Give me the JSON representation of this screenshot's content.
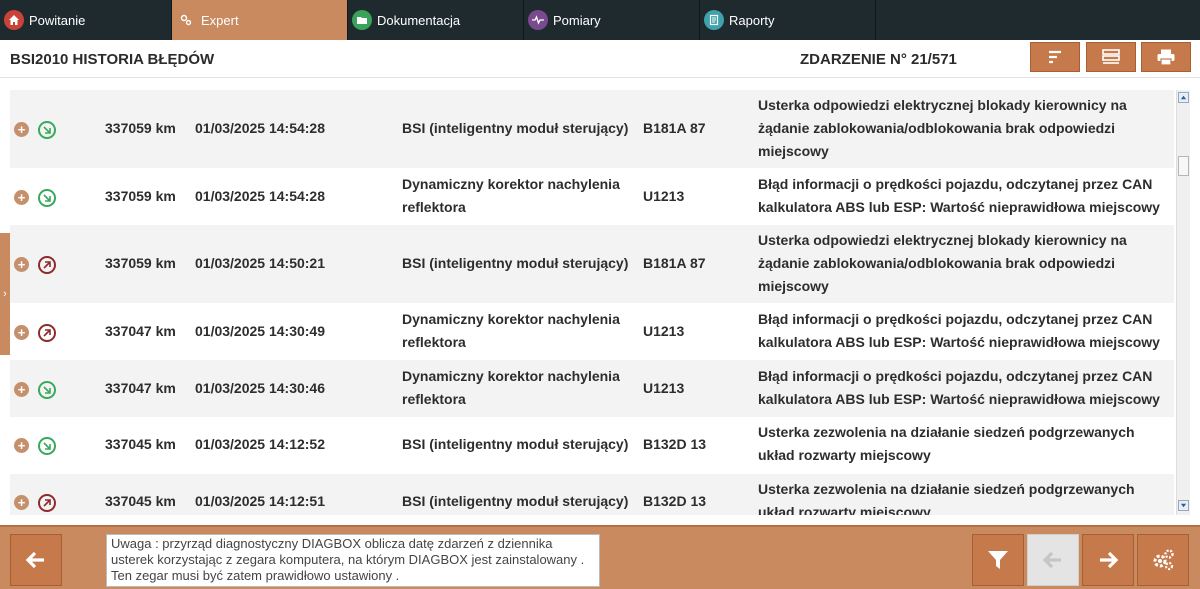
{
  "nav": {
    "tabs": [
      {
        "label": "Powitanie",
        "icon": "home-icon",
        "color": "#c8443a"
      },
      {
        "label": "Expert",
        "icon": "gears-icon",
        "color": "#c98a5f",
        "active": true
      },
      {
        "label": "Dokumentacja",
        "icon": "folder-icon",
        "color": "#3aa35a"
      },
      {
        "label": "Pomiary",
        "icon": "pulse-icon",
        "color": "#7a4a8e"
      },
      {
        "label": "Raporty",
        "icon": "report-icon",
        "color": "#3fa2ad"
      }
    ]
  },
  "header": {
    "title": "BSI2010 HISTORIA BŁĘDÓW",
    "event_counter": "ZDARZENIE N° 21/571",
    "buttons": [
      "sort-icon",
      "list-icon",
      "print-icon"
    ]
  },
  "faults": [
    {
      "status": "green",
      "km": "337059 km",
      "datetime": "01/03/2025 14:54:28",
      "module": "BSI (inteligentny moduł sterujący)",
      "code": "B181A 87",
      "description": "Usterka odpowiedzi elektrycznej blokady kierownicy na żądanie zablokowania/odblokowania brak odpowiedzi miejscowy"
    },
    {
      "status": "green",
      "km": "337059 km",
      "datetime": "01/03/2025 14:54:28",
      "module": "Dynamiczny korektor nachylenia reflektora",
      "code": "U1213",
      "description": "Błąd informacji o prędkości pojazdu, odczytanej przez CAN kalkulatora ABS lub ESP: Wartość nieprawidłowa miejscowy"
    },
    {
      "status": "red",
      "km": "337059 km",
      "datetime": "01/03/2025 14:50:21",
      "module": "BSI (inteligentny moduł sterujący)",
      "code": "B181A 87",
      "description": "Usterka odpowiedzi elektrycznej blokady kierownicy na żądanie zablokowania/odblokowania brak odpowiedzi miejscowy"
    },
    {
      "status": "red",
      "km": "337047 km",
      "datetime": "01/03/2025 14:30:49",
      "module": "Dynamiczny korektor nachylenia reflektora",
      "code": "U1213",
      "description": "Błąd informacji o prędkości pojazdu, odczytanej przez CAN kalkulatora ABS lub ESP: Wartość nieprawidłowa miejscowy"
    },
    {
      "status": "green",
      "km": "337047 km",
      "datetime": "01/03/2025 14:30:46",
      "module": "Dynamiczny korektor nachylenia reflektora",
      "code": "U1213",
      "description": "Błąd informacji o prędkości pojazdu, odczytanej przez CAN kalkulatora ABS lub ESP: Wartość nieprawidłowa miejscowy"
    },
    {
      "status": "green",
      "km": "337045 km",
      "datetime": "01/03/2025 14:12:52",
      "module": "BSI (inteligentny moduł sterujący)",
      "code": "B132D 13",
      "description": "Usterka zezwolenia na działanie siedzeń podgrzewanych układ rozwarty miejscowy"
    },
    {
      "status": "red",
      "km": "337045 km",
      "datetime": "01/03/2025 14:12:51",
      "module": "BSI (inteligentny moduł sterujący)",
      "code": "B132D 13",
      "description": "Usterka zezwolenia na działanie siedzeń podgrzewanych układ rozwarty miejscowy"
    }
  ],
  "footer": {
    "notice": "Uwaga : przyrząd diagnostyczny DIAGBOX oblicza datę zdarzeń z dziennika usterek korzystając z zegara komputera, na którym DIAGBOX jest zainstalowany . Ten zegar musi być zatem prawidłowo ustawiony ."
  },
  "colors": {
    "accent": "#c98a5f",
    "button": "#c6794a",
    "nav_bg": "#1f2a2e",
    "status_green": "#39a95b",
    "status_red": "#8e2b2b"
  }
}
